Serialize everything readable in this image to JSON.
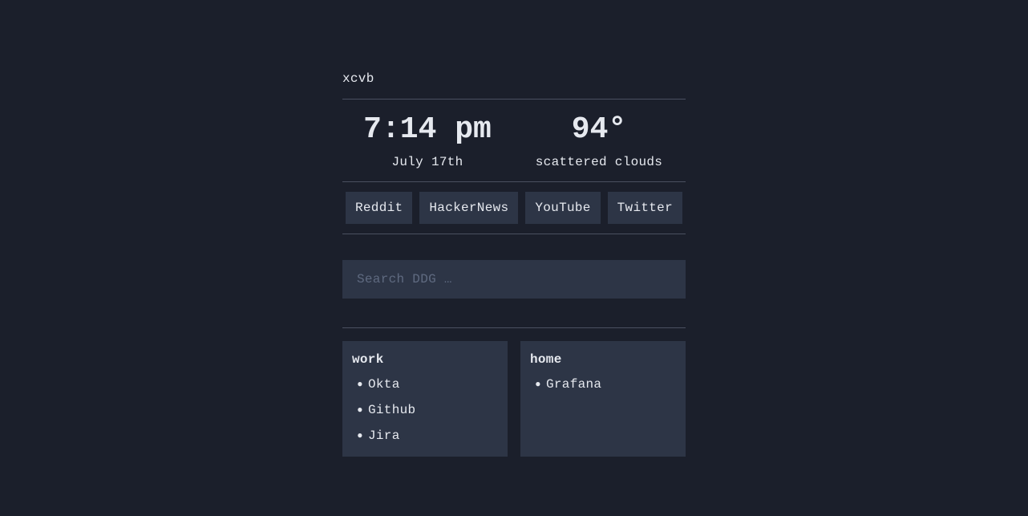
{
  "greeting": "xcvb",
  "clock": {
    "time": "7:14 pm",
    "date": "July 17th"
  },
  "weather": {
    "temperature": "94°",
    "condition": "scattered clouds"
  },
  "quick_links": [
    {
      "label": "Reddit"
    },
    {
      "label": "HackerNews"
    },
    {
      "label": "YouTube"
    },
    {
      "label": "Twitter"
    }
  ],
  "search": {
    "placeholder": "Search DDG …",
    "value": ""
  },
  "bookmark_groups": [
    {
      "title": "work",
      "items": [
        {
          "label": "Okta"
        },
        {
          "label": "Github"
        },
        {
          "label": "Jira"
        }
      ]
    },
    {
      "title": "home",
      "items": [
        {
          "label": "Grafana"
        }
      ]
    }
  ]
}
